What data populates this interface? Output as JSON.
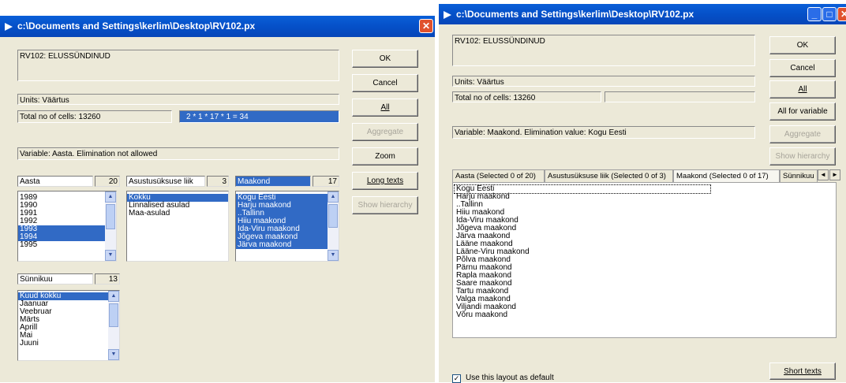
{
  "left_window": {
    "title": "c:\\Documents and Settings\\kerlim\\Desktop\\RV102.px",
    "table_name": "RV102: ELUSSÜNDINUD",
    "units": "Units: Väärtus",
    "total_cells": "Total no of cells:  13260",
    "cell_formula": "2 * 1 * 17 * 1 = 34",
    "variable_info": "Variable: Aasta. Elimination not allowed",
    "buttons": {
      "ok": "OK",
      "cancel": "Cancel",
      "all": "All",
      "aggregate": "Aggregate",
      "zoom": "Zoom",
      "long_texts": "Long texts",
      "show_hierarchy": "Show hierarchy"
    },
    "variables": {
      "aasta": {
        "name": "Aasta",
        "count": "20",
        "items": [
          "1989",
          "1990",
          "1991",
          "1992",
          "1993",
          "1994",
          "1995"
        ],
        "selected": [
          4,
          5
        ]
      },
      "asustus": {
        "name": "Asustusüksuse liik",
        "count": "3",
        "items": [
          "Kokku",
          "Linnalised asulad",
          "Maa-asulad"
        ],
        "selected": [
          0
        ]
      },
      "maakond": {
        "name": "Maakond",
        "count": "17",
        "items": [
          "Kogu Eesti",
          "Harju maakond",
          "..Tallinn",
          "Hiiu maakond",
          "Ida-Viru maakond",
          "Jõgeva maakond",
          "Järva maakond"
        ],
        "selected": [
          0,
          1,
          2,
          3,
          4,
          5,
          6
        ]
      },
      "synnikuu": {
        "name": "Sünnikuu",
        "count": "13",
        "items": [
          "Kuud kokku",
          "Jaanuar",
          "Veebruar",
          "Märts",
          "Aprill",
          "Mai",
          "Juuni"
        ],
        "selected": [
          0
        ]
      }
    }
  },
  "right_window": {
    "title": "c:\\Documents and Settings\\kerlim\\Desktop\\RV102.px",
    "table_name": "RV102: ELUSSÜNDINUD",
    "units": "Units: Väärtus",
    "total_cells": "Total no of cells:  13260",
    "variable_info": "Variable: Maakond. Elimination value: Kogu Eesti",
    "buttons": {
      "ok": "OK",
      "cancel": "Cancel",
      "all": "All",
      "all_for_variable": "All for variable",
      "aggregate": "Aggregate",
      "show_hierarchy": "Show hierarchy",
      "short_texts": "Short texts"
    },
    "tabs": [
      "Aasta  (Selected 0 of  20)",
      "Asustusüksuse liik  (Selected 0 of  3)",
      "Maakond  (Selected 0 of  17)",
      "Sünnikuu"
    ],
    "active_tab": 2,
    "list_items": [
      "Kogu Eesti",
      "Harju maakond",
      "..Tallinn",
      "Hiiu maakond",
      "Ida-Viru maakond",
      "Jõgeva maakond",
      "Järva maakond",
      "Lääne maakond",
      "Lääne-Viru maakond",
      "Põlva maakond",
      "Pärnu maakond",
      "Rapla maakond",
      "Saare maakond",
      "Tartu maakond",
      "Valga maakond",
      "Viljandi maakond",
      "Võru maakond"
    ],
    "default_checkbox_label": "Use this layout as default",
    "default_checked": true
  },
  "colors": {
    "selection": "#316ac5",
    "dialog": "#ece9d8",
    "titlebar": "#0550c8"
  }
}
